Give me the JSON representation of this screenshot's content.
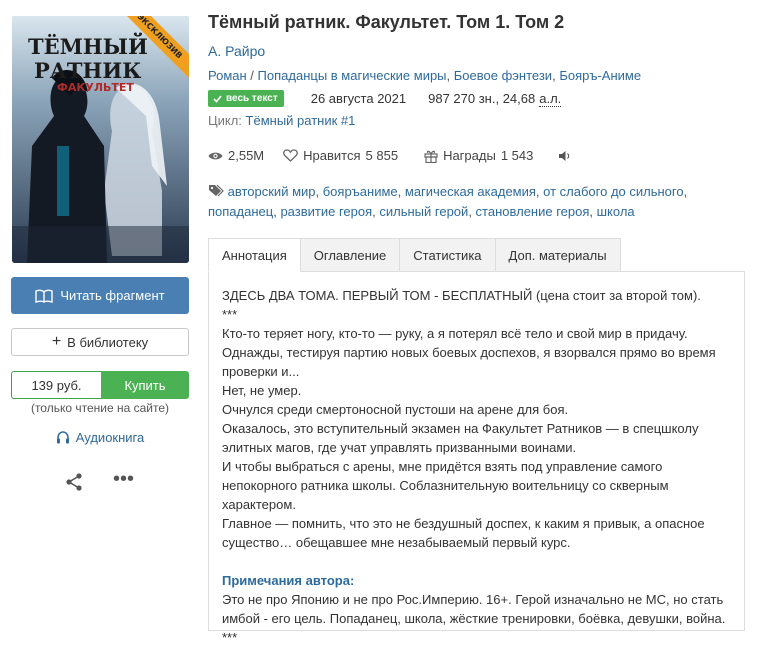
{
  "book": {
    "title": "Тёмный ратник. Факультет. Том 1. Том 2",
    "author": "А. Райро",
    "genres": [
      "Роман",
      "Попаданцы в магические миры",
      "Боевое фэнтези",
      "Бояръ-Аниме"
    ],
    "badge": "весь текст",
    "date": "26 августа 2021",
    "size": "987 270 зн., 24,68",
    "size_unit": "а.л.",
    "cycle_label": "Цикл:",
    "cycle_name": "Тёмный ратник #1"
  },
  "cover": {
    "title_line1": "ТЁМНЫЙ",
    "title_line2": "РАТНИК",
    "title_line3": "ФАКУЛЬТЕТ",
    "ribbon": "ЭКСКЛЮЗИВ"
  },
  "actions": {
    "read_fragment": "Читать фрагмент",
    "add_library": "В библиотеку",
    "price": "139 руб.",
    "buy": "Купить",
    "buy_note": "(только чтение на сайте)",
    "audiobook": "Аудиокнига"
  },
  "stats": {
    "views": "2,55M",
    "likes_label": "Нравится",
    "likes": "5 855",
    "awards_label": "Награды",
    "awards": "1 543"
  },
  "tags": [
    "авторский мир",
    "бояръаниме",
    "магическая академия",
    "от слабого до сильного",
    "попаданец",
    "развитие героя",
    "сильный герой",
    "становление героя",
    "школа"
  ],
  "tabs": [
    "Аннотация",
    "Оглавление",
    "Статистика",
    "Доп. материалы"
  ],
  "annotation": {
    "lines": [
      "ЗДЕСЬ ДВА ТОМА. ПЕРВЫЙ ТОМ - БЕСПЛАТНЫЙ (цена стоит за второй том).",
      "***",
      "Кто-то теряет ногу, кто-то — руку, а я потерял всё тело и свой мир в придачу.",
      "Однажды, тестируя партию новых боевых доспехов, я взорвался прямо во время проверки и...",
      "Нет, не умер.",
      "Очнулся среди смертоносной пустоши на арене для боя.",
      "Оказалось, это вступительный экзамен на Факультет Ратников — в спецшколу элитных магов, где учат управлять призванными воинами.",
      "И чтобы выбраться с арены, мне придётся взять под управление самого непокорного ратника школы. Соблазнительную воительницу со скверным характером.",
      "Главное — помнить, что это не бездушный доспех, к каким я привык, а опасное существо… обещавшее мне незабываемый первый курс."
    ],
    "notes_title": "Примечания автора:",
    "notes_lines": [
      "Это не про Японию и не про Рос.Империю. 16+. Герой изначально не МС, но стать имбой - его цель. Попаданец, школа, жёсткие тренировки, боёвка, девушки, война.",
      "***"
    ]
  },
  "colors": {
    "link": "#2f6a9c",
    "read_button": "#4a7fb4",
    "buy_button": "#4bb254",
    "badge": "#4bb254",
    "ribbon": "#f0a020"
  }
}
